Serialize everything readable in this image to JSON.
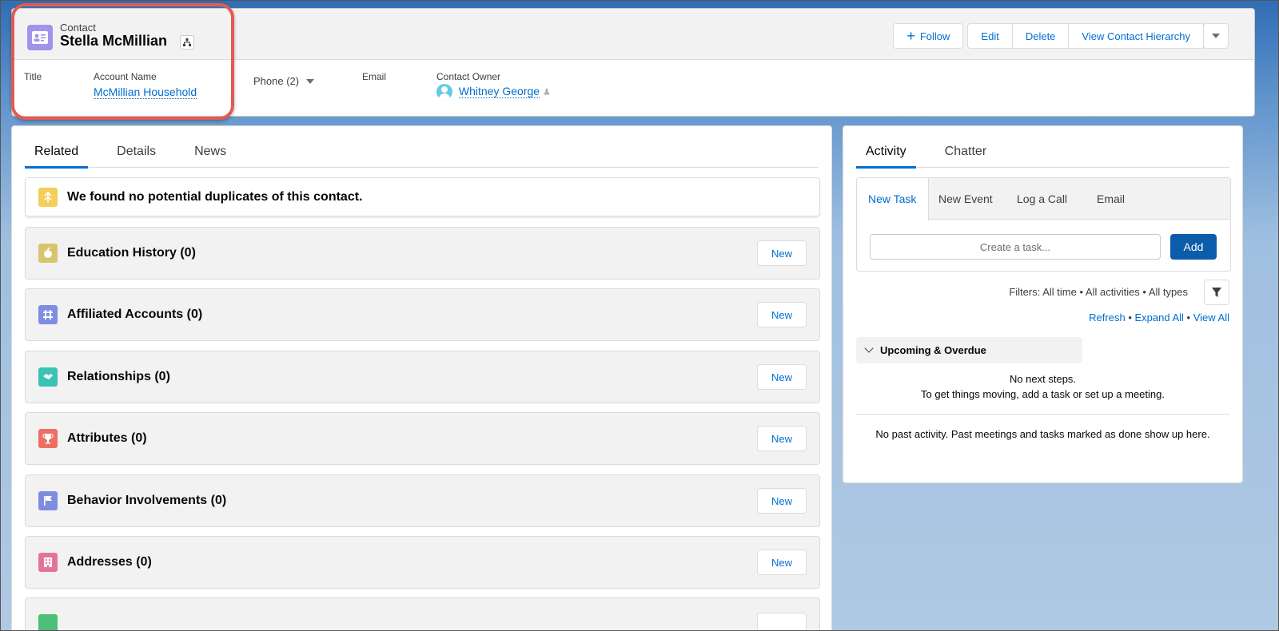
{
  "header": {
    "object_type": "Contact",
    "record_name": "Stella McMillian",
    "actions": {
      "follow": "Follow",
      "edit": "Edit",
      "delete": "Delete",
      "hierarchy": "View Contact Hierarchy"
    },
    "fields": {
      "title_label": "Title",
      "account_label": "Account Name",
      "account_value": "McMillian Household",
      "phone_label": "Phone (2)",
      "email_label": "Email",
      "owner_label": "Contact Owner",
      "owner_value": "Whitney George"
    },
    "highlight_color": "#e15b54"
  },
  "left_panel": {
    "tabs": [
      "Related",
      "Details",
      "News"
    ],
    "active_tab": "Related",
    "duplicates_message": "We found no potential duplicates of this contact.",
    "related_lists": [
      {
        "title": "Education History (0)",
        "icon": "education-icon",
        "color": "#d8c46b",
        "button": "New"
      },
      {
        "title": "Affiliated Accounts (0)",
        "icon": "affiliation-icon",
        "color": "#7f8de1",
        "button": "New"
      },
      {
        "title": "Relationships (0)",
        "icon": "handshake-icon",
        "color": "#3cc2b3",
        "button": "New"
      },
      {
        "title": "Attributes (0)",
        "icon": "trophy-icon",
        "color": "#ef6e64",
        "button": "New"
      },
      {
        "title": "Behavior Involvements (0)",
        "icon": "flag-icon",
        "color": "#7f8de1",
        "button": "New"
      },
      {
        "title": "Addresses (0)",
        "icon": "building-icon",
        "color": "#e3739a",
        "button": "New"
      }
    ]
  },
  "right_panel": {
    "tabs": [
      "Activity",
      "Chatter"
    ],
    "active_tab": "Activity",
    "publisher_tabs": [
      "New Task",
      "New Event",
      "Log a Call",
      "Email"
    ],
    "task_placeholder": "Create a task...",
    "add_label": "Add",
    "filters_text": "Filters: All time • All activities • All types",
    "links": {
      "refresh": "Refresh",
      "expand": "Expand All",
      "view_all": "View All",
      "sep": " • "
    },
    "upcoming_title": "Upcoming & Overdue",
    "no_next_line1": "No next steps.",
    "no_next_line2": "To get things moving, add a task or set up a meeting.",
    "no_past": "No past activity. Past meetings and tasks marked as done show up here."
  }
}
